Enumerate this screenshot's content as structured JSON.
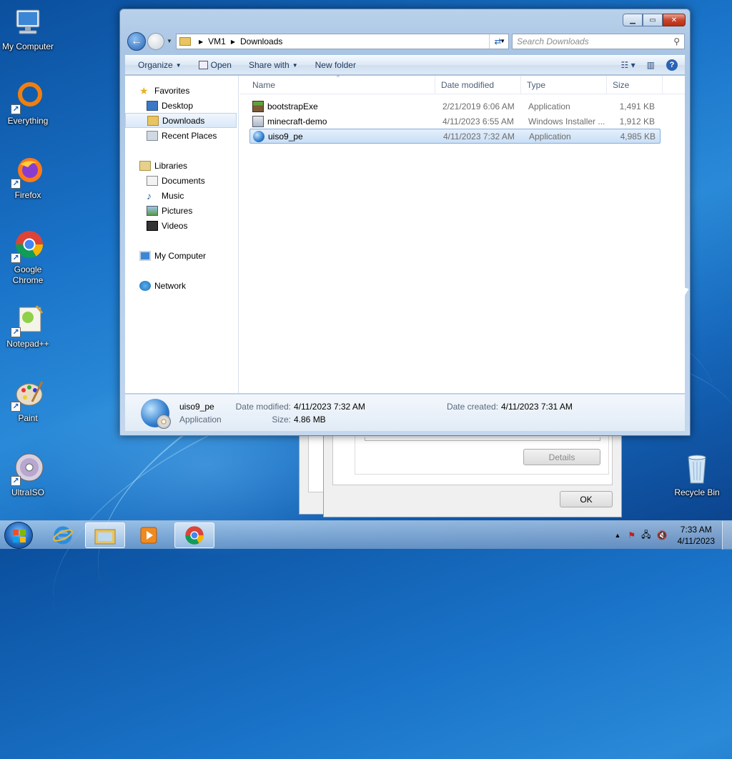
{
  "desktop": {
    "icons": [
      {
        "label": "My Computer"
      },
      {
        "label": "Everything"
      },
      {
        "label": "Firefox"
      },
      {
        "label": "Google Chrome"
      },
      {
        "label": "Notepad++"
      },
      {
        "label": "Paint"
      },
      {
        "label": "UltraISO"
      },
      {
        "label": "Recycle Bin"
      }
    ]
  },
  "explorer": {
    "breadcrumb": [
      "VM1",
      "Downloads"
    ],
    "search_placeholder": "Search Downloads",
    "toolbar": {
      "organize": "Organize",
      "open": "Open",
      "share_with": "Share with",
      "new_folder": "New folder"
    },
    "nav": {
      "favorites": "Favorites",
      "desktop": "Desktop",
      "downloads": "Downloads",
      "recent": "Recent Places",
      "libraries": "Libraries",
      "documents": "Documents",
      "music": "Music",
      "pictures": "Pictures",
      "videos": "Videos",
      "my_computer": "My Computer",
      "network": "Network"
    },
    "columns": {
      "name": "Name",
      "date": "Date modified",
      "type": "Type",
      "size": "Size"
    },
    "files": [
      {
        "name": "bootstrapExe",
        "date": "2/21/2019 6:06 AM",
        "type": "Application",
        "size": "1,491 KB",
        "icon": "minecraft-block-icon"
      },
      {
        "name": "minecraft-demo",
        "date": "4/11/2023 6:55 AM",
        "type": "Windows Installer ...",
        "size": "1,912 KB",
        "icon": "installer-icon"
      },
      {
        "name": "uiso9_pe",
        "date": "4/11/2023 7:32 AM",
        "type": "Application",
        "size": "4,985 KB",
        "icon": "ultraiso-globe-icon"
      }
    ],
    "details": {
      "name": "uiso9_pe",
      "kind": "Application",
      "date_modified_label": "Date modified:",
      "date_modified": "4/11/2023 7:32 AM",
      "date_created_label": "Date created:",
      "date_created": "4/11/2023 7:31 AM",
      "size_label": "Size:",
      "size": "4.86 MB"
    }
  },
  "dialog": {
    "details_button": "Details",
    "ok_button": "OK"
  },
  "taskbar": {
    "time": "7:33 AM",
    "date": "4/11/2023"
  }
}
